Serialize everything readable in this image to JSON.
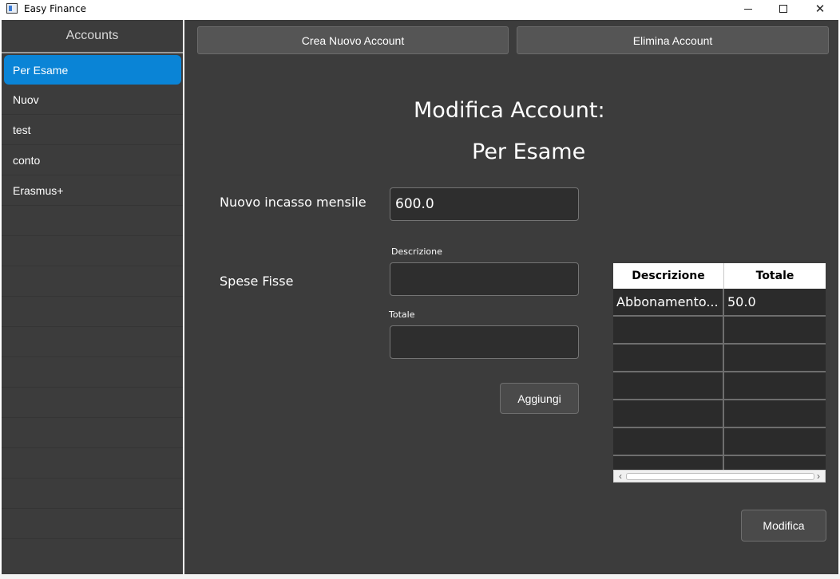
{
  "window": {
    "title": "Easy Finance",
    "minimize_label": "",
    "maximize_label": "",
    "close_label": "✕"
  },
  "sidebar": {
    "header": "Accounts",
    "items": [
      {
        "label": "Per Esame",
        "selected": true
      },
      {
        "label": "Nuov"
      },
      {
        "label": "test"
      },
      {
        "label": "conto"
      },
      {
        "label": "Erasmus+"
      }
    ]
  },
  "toolbar": {
    "create_label": "Crea Nuovo Account",
    "delete_label": "Elimina Account"
  },
  "edit": {
    "title": "Modifica Account:",
    "account_name": "Per Esame",
    "income_label": "Nuovo incasso mensile",
    "income_value": "600.0",
    "fixed_label": "Spese Fisse",
    "desc_label": "Descrizione",
    "desc_value": "",
    "total_label": "Totale",
    "total_value": "",
    "add_label": "Aggiungi",
    "modify_label": "Modifica"
  },
  "table": {
    "columns": [
      "Descrizione",
      "Totale"
    ],
    "rows": [
      [
        "Abbonamento...",
        "50.0"
      ]
    ]
  },
  "colors": {
    "background": "#3c3c3c",
    "selection": "#0a84d6",
    "field": "#2e2e2e"
  }
}
